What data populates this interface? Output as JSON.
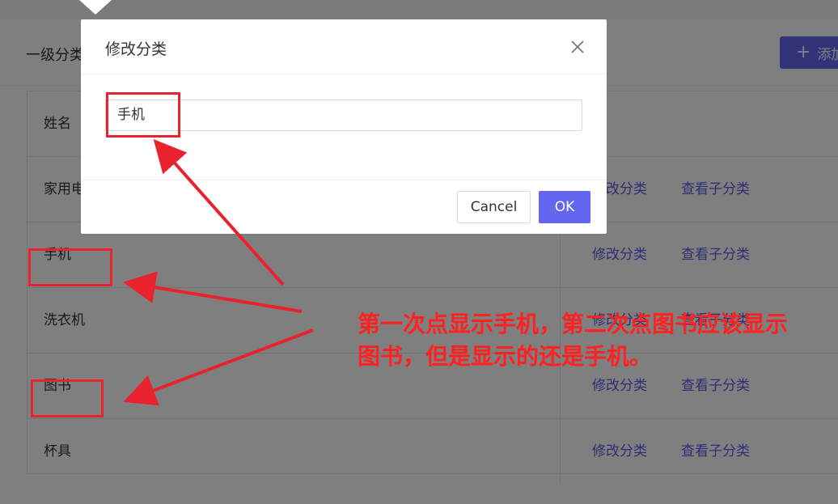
{
  "page": {
    "card_title": "一级分类",
    "add_button_label": "添加",
    "table_header": "姓名",
    "rows": [
      {
        "name": "家用电器",
        "edit": "修改分类",
        "view": "查看子分类"
      },
      {
        "name": "手机",
        "edit": "修改分类",
        "view": "查看子分类"
      },
      {
        "name": "洗衣机",
        "edit": "修改分类",
        "view": "查看子分类"
      },
      {
        "name": "图书",
        "edit": "修改分类",
        "view": "查看子分类"
      },
      {
        "name": "杯具",
        "edit": "修改分类",
        "view": "查看子分类"
      }
    ]
  },
  "dialog": {
    "title": "修改分类",
    "input_value": "手机",
    "cancel_label": "Cancel",
    "ok_label": "OK"
  },
  "annotation": {
    "line1": "第一次点显示手机，第二次点图书应该显示",
    "line2": "图书，但是显示的还是手机。"
  },
  "colors": {
    "primary": "#6566f0",
    "link": "#5b5ce6",
    "annotation_red": "#e8232d"
  }
}
